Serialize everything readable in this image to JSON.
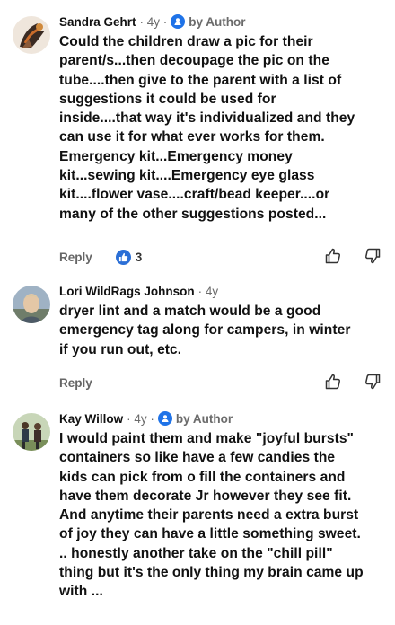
{
  "comments": [
    {
      "author": "Sandra Gehrt",
      "age": "· 4y ·",
      "badge_label": "by Author",
      "lines": [
        "Could the children draw a pic for their",
        "parent/s...then decoupage the pic on the",
        "tube....then give to the parent with a list of",
        "suggestions it could be used for",
        "inside....that way it's individualized and they",
        "can use it for what ever works for them.",
        "Emergency kit...Emergency money",
        "kit...sewing kit....Emergency eye glass",
        "kit....flower vase....craft/bead keeper....or",
        "many of the other suggestions posted..."
      ],
      "reply_label": "Reply",
      "like_count": "3"
    },
    {
      "author": "Lori WildRags Johnson",
      "age": "· 4y",
      "lines": [
        "dryer lint and a match would be a good",
        "emergency tag along for campers, in winter",
        "if you run out, etc."
      ],
      "reply_label": "Reply"
    },
    {
      "author": "Kay Willow",
      "age": "· 4y ·",
      "badge_label": "by Author",
      "lines": [
        "I would paint them and make \"joyful bursts\"",
        "containers so like have a few candies the",
        "kids can pick from o fill the containers and",
        "have them decorate Jr however they see fit.",
        "And anytime their parents need a extra burst",
        "of joy they can have a little something sweet.",
        ".. honestly another take on the \"chill pill\"",
        "thing but it's the only thing my brain came up",
        "with ..."
      ]
    }
  ],
  "colors": {
    "accent": "#1f73e8",
    "meta_gray": "#6b6b6b"
  },
  "icons": {
    "author_badge": "user-badge-icon",
    "like_badge": "thumbs-up-filled-icon",
    "upvote": "thumbs-up-outline-icon",
    "downvote": "thumbs-down-outline-icon"
  }
}
